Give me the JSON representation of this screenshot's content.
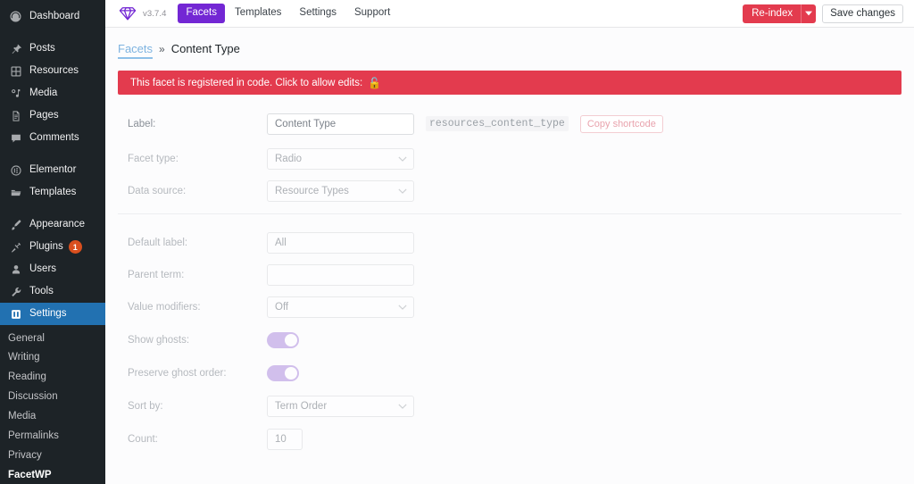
{
  "sidebar": {
    "items": [
      {
        "label": "Dashboard",
        "icon": "dashboard-icon",
        "name": "dashboard"
      },
      {
        "label": "Posts",
        "icon": "pin-icon",
        "name": "posts"
      },
      {
        "label": "Resources",
        "icon": "grid-icon",
        "name": "resources"
      },
      {
        "label": "Media",
        "icon": "media-icon",
        "name": "media"
      },
      {
        "label": "Pages",
        "icon": "pages-icon",
        "name": "pages"
      },
      {
        "label": "Comments",
        "icon": "comment-icon",
        "name": "comments"
      },
      {
        "label": "Elementor",
        "icon": "elementor-icon",
        "name": "elementor"
      },
      {
        "label": "Templates",
        "icon": "folder-icon",
        "name": "templates"
      },
      {
        "label": "Appearance",
        "icon": "brush-icon",
        "name": "appearance"
      },
      {
        "label": "Plugins",
        "icon": "plug-icon",
        "name": "plugins",
        "badge": "1"
      },
      {
        "label": "Users",
        "icon": "user-icon",
        "name": "users"
      },
      {
        "label": "Tools",
        "icon": "wrench-icon",
        "name": "tools"
      },
      {
        "label": "Settings",
        "icon": "settings-icon",
        "name": "settings",
        "active": true
      }
    ],
    "submenu": [
      {
        "label": "General"
      },
      {
        "label": "Writing"
      },
      {
        "label": "Reading"
      },
      {
        "label": "Discussion"
      },
      {
        "label": "Media"
      },
      {
        "label": "Permalinks"
      },
      {
        "label": "Privacy"
      },
      {
        "label": "FacetWP",
        "current": true
      }
    ]
  },
  "topbar": {
    "logo_icon": "facetwp-diamond-logo",
    "version": "v3.7.4",
    "nav": [
      {
        "label": "Facets",
        "active": true
      },
      {
        "label": "Templates",
        "active": false
      },
      {
        "label": "Settings",
        "active": false
      },
      {
        "label": "Support",
        "active": false
      }
    ],
    "reindex_label": "Re-index",
    "reindex_caret_icon": "caret-down-icon",
    "save_label": "Save changes"
  },
  "breadcrumb": {
    "parent": "Facets",
    "separator": "»",
    "current": "Content Type"
  },
  "notice": {
    "text": "This facet is registered in code. Click to allow edits:",
    "lock_icon": "unlock-icon",
    "lock_glyph": "🔓",
    "color": "#e33b4e"
  },
  "form": {
    "label": {
      "label": "Label:",
      "value": "Content Type",
      "code": "resources_content_type",
      "copy_button": "Copy shortcode"
    },
    "facet_type": {
      "label": "Facet type:",
      "value": "Radio"
    },
    "data_source": {
      "label": "Data source:",
      "value": "Resource Types"
    },
    "default_label": {
      "label": "Default label:",
      "value": "All"
    },
    "parent_term": {
      "label": "Parent term:",
      "value": ""
    },
    "value_modifiers": {
      "label": "Value modifiers:",
      "value": "Off"
    },
    "show_ghosts": {
      "label": "Show ghosts:",
      "value": "on"
    },
    "preserve_ghost_order": {
      "label": "Preserve ghost order:",
      "value": "on"
    },
    "sort_by": {
      "label": "Sort by:",
      "value": "Term Order"
    },
    "count": {
      "label": "Count:",
      "value": "10"
    }
  },
  "colors": {
    "brand_purple": "#7327d4",
    "danger_red": "#e33b4e",
    "wp_blue": "#2271b1",
    "sidebar_dark": "#1d2327",
    "toggle_on": "#b79be2"
  }
}
